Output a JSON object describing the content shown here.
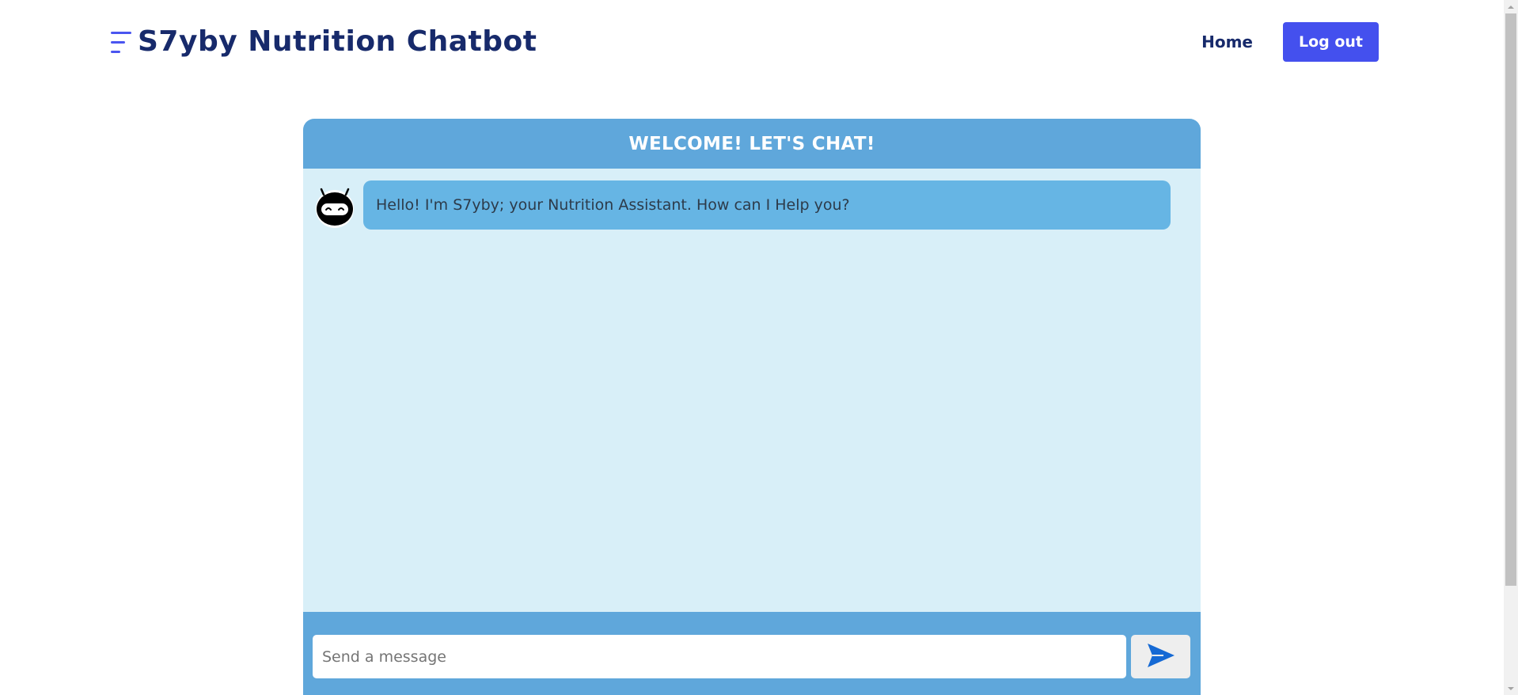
{
  "header": {
    "brand_title": "S7yby Nutrition Chatbot",
    "nav_home": "Home",
    "logout_label": "Log out"
  },
  "chat": {
    "title": "WELCOME! LET'S CHAT!",
    "messages": [
      {
        "sender": "bot",
        "avatar_icon": "robot-icon",
        "text": "Hello! I'm S7yby; your Nutrition Assistant. How can I Help you?"
      }
    ],
    "input": {
      "value": "",
      "placeholder": "Send a message"
    },
    "send_icon": "send-icon"
  },
  "colors": {
    "accent": "#4450ee",
    "brand_text": "#172a6b",
    "chat_header": "#5fa7db",
    "chat_body": "#d8eff8",
    "bot_bubble": "#66b5e4",
    "send_arrow": "#1569d4"
  }
}
